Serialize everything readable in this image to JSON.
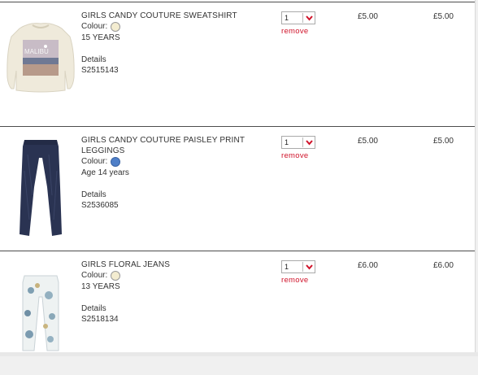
{
  "items": [
    {
      "name": "GIRLS CANDY COUTURE SWEATSHIRT",
      "colour_label": "Colour:",
      "colour_hex": "#f3ecd0",
      "size": "15 YEARS",
      "details_label": "Details",
      "sku": "S2515143",
      "qty": "1",
      "remove_label": "remove",
      "price": "£5.00",
      "total": "£5.00",
      "image_icon": "sweatshirt-image"
    },
    {
      "name": "GIRLS CANDY COUTURE PAISLEY PRINT LEGGINGS",
      "colour_label": "Colour:",
      "colour_hex": "#4f7fc8",
      "size": "Age 14 years",
      "details_label": "Details",
      "sku": "S2536085",
      "qty": "1",
      "remove_label": "remove",
      "price": "£5.00",
      "total": "£5.00",
      "image_icon": "leggings-image"
    },
    {
      "name": "GIRLS FLORAL JEANS",
      "colour_label": "Colour:",
      "colour_hex": "#f3ecd0",
      "size": "13 YEARS",
      "details_label": "Details",
      "sku": "S2518134",
      "qty": "1",
      "remove_label": "remove",
      "price": "£6.00",
      "total": "£6.00",
      "image_icon": "floral-jeans-image"
    }
  ],
  "colors": {
    "remove": "#d0142b",
    "chevron": "#d0142b",
    "divider": "#4d4d4d"
  }
}
